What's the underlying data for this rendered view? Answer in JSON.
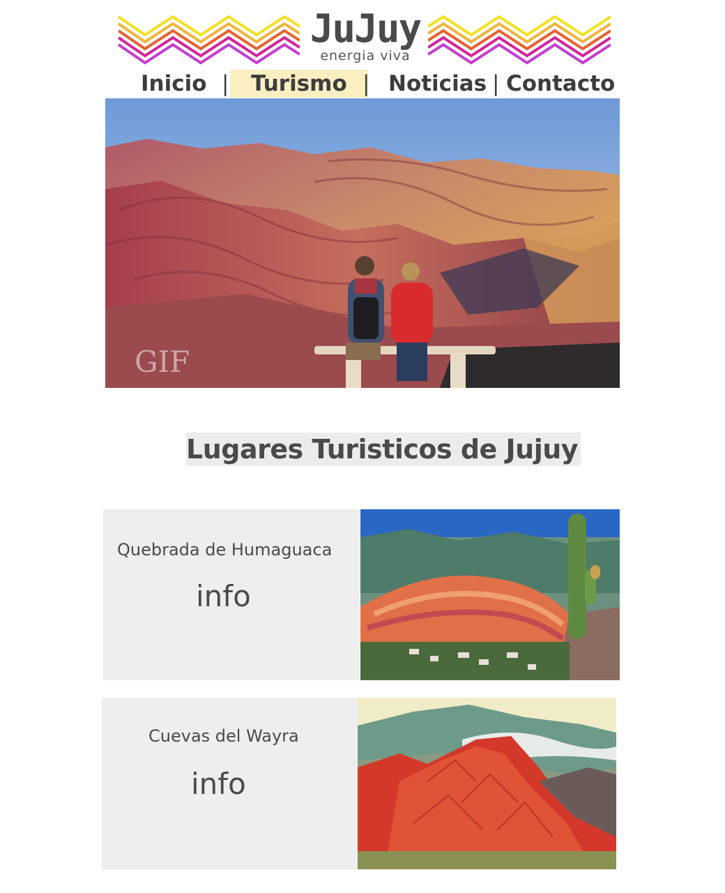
{
  "header": {
    "brand_title": "JuJuy",
    "brand_tagline": "energia viva",
    "zigzag_colors": [
      "#f3e020",
      "#e8602d",
      "#d6219a",
      "#c43bd1"
    ]
  },
  "nav": {
    "items": [
      {
        "label": "Inicio",
        "active": false
      },
      {
        "label": "Turismo",
        "active": true
      },
      {
        "label": "Noticias",
        "active": false
      },
      {
        "label": "Contacto",
        "active": false
      }
    ],
    "separator": "|",
    "active_color": "#fbeec1"
  },
  "hero": {
    "watermark": "GIF",
    "scene": "couple-on-bench-facing-colorful-mountains"
  },
  "section": {
    "title": "Lugares Turisticos de Jujuy"
  },
  "places": [
    {
      "name": "Quebrada de Humaguaca",
      "link_label": "info",
      "image": "cerro-siete-colores-with-cactus"
    },
    {
      "name": "Cuevas del Wayra",
      "link_label": "info",
      "image": "red-rock-mountain"
    }
  ]
}
